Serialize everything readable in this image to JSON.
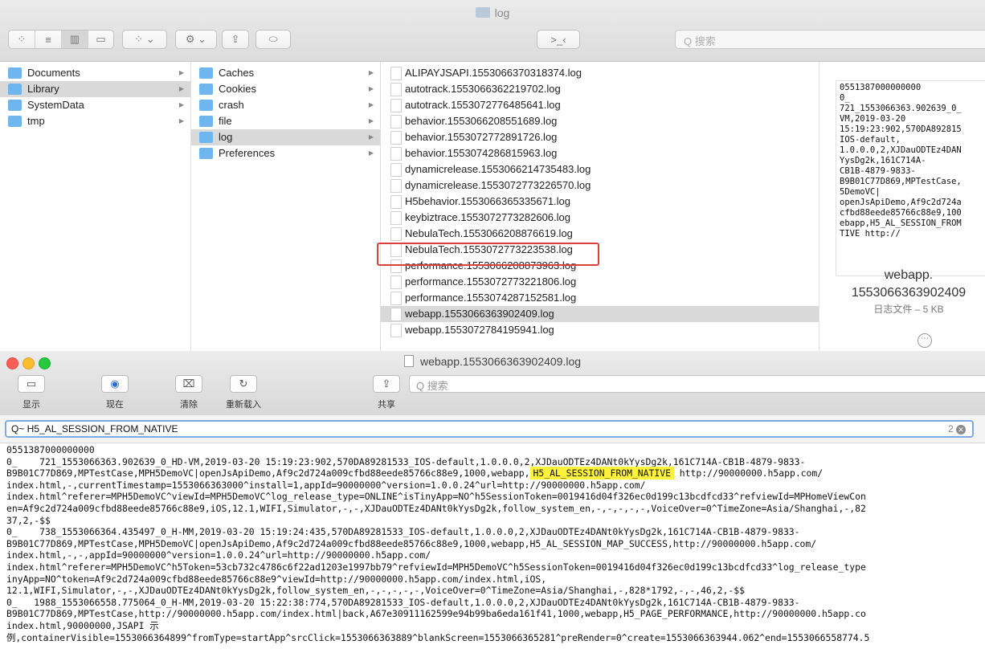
{
  "finder": {
    "title": "log",
    "search_placeholder": "Q 搜索",
    "view_buttons": [
      "icon-view",
      "list-view",
      "column-view",
      "gallery-view"
    ],
    "column1": [
      {
        "label": "Documents",
        "has_children": true
      },
      {
        "label": "Library",
        "has_children": true,
        "selected": true
      },
      {
        "label": "SystemData",
        "has_children": true
      },
      {
        "label": "tmp",
        "has_children": true
      }
    ],
    "column2": [
      {
        "label": "Caches",
        "has_children": true
      },
      {
        "label": "Cookies",
        "has_children": true
      },
      {
        "label": "crash",
        "has_children": true
      },
      {
        "label": "file",
        "has_children": true
      },
      {
        "label": "log",
        "has_children": true,
        "selected": true
      },
      {
        "label": "Preferences",
        "has_children": true
      }
    ],
    "files": [
      "ALIPAYJSAPI.1553066370318374.log",
      "autotrack.1553066362219702.log",
      "autotrack.1553072776485641.log",
      "behavior.1553066208551689.log",
      "behavior.1553072772891726.log",
      "behavior.1553074286815963.log",
      "dynamicrelease.1553066214735483.log",
      "dynamicrelease.1553072773226570.log",
      "H5behavior.1553066365335671.log",
      "keybiztrace.1553072773282606.log",
      "NebulaTech.1553066208876619.log",
      "NebulaTech.1553072773223538.log",
      "performance.1553066208873963.log",
      "performance.1553072773221806.log",
      "performance.1553074287152581.log",
      "webapp.1553066363902409.log",
      "webapp.1553072784195941.log"
    ],
    "selected_file_index": 15,
    "preview": {
      "text": "0551387000000000\n0_\n721_1553066363.902639_0_\nVM,2019-03-20\n15:19:23:902,570DA892815\nIOS-default,\n1.0.0.0,2,XJDauODTEz4DAN\nYysDg2k,161C714A-\nCB1B-4879-9833-\nB9B01C77D869,MPTestCase,\n5DemoVC|\nopenJsApiDemo,Af9c2d724a\ncfbd88eede85766c88e9,100\nebapp,H5_AL_SESSION_FROM\nTIVE http://",
      "name": "webapp.\n1553066363902409",
      "meta": "日志文件 – 5 KB"
    }
  },
  "console": {
    "title": "webapp.1553066363902409.log",
    "toolbar": [
      {
        "name": "show-button",
        "label": "显示",
        "glyph": "▭"
      },
      {
        "name": "now-button",
        "label": "现在",
        "glyph": "◉"
      },
      {
        "name": "clear-button",
        "label": "清除",
        "glyph": "⌧"
      },
      {
        "name": "reload-button",
        "label": "重新载入",
        "glyph": "↻"
      },
      {
        "name": "share-button",
        "label": "共享",
        "glyph": "⇪"
      }
    ],
    "search_placeholder": "Q 搜索",
    "filter_value": "Q~ H5_AL_SESSION_FROM_NATIVE",
    "filter_count": "2",
    "highlight": "H5_AL_SESSION_FROM_NATIVE",
    "log_lines": [
      "0551387000000000",
      "0_    721_1553066363.902639_0_HD-VM,2019-03-20 15:19:23:902,570DA89281533_IOS-default,1.0.0.0,2,XJDauODTEz4DANt0kYysDg2k,161C714A-CB1B-4879-9833-",
      "B9B01C77D869,MPTestCase,MPH5DemoVC|openJsApiDemo,Af9c2d724a009cfbd88eede85766c88e9,1000,webapp,{{HL}} http://90000000.h5app.com/",
      "index.html,-,currentTimestamp=1553066363000^install=1,appId=90000000^version=1.0.0.24^url=http://90000000.h5app.com/",
      "index.html^referer=MPH5DemoVC^viewId=MPH5DemoVC^log_release_type=ONLINE^isTinyApp=NO^h5SessionToken=0019416d04f326ec0d199c13bcdfcd33^refviewId=MPHomeViewCon",
      "en=Af9c2d724a009cfbd88eede85766c88e9,iOS,12.1,WIFI,Simulator,-,-,XJDauODTEz4DANt0kYysDg2k,follow_system_en,-,-,-,-,-,VoiceOver=0^TimeZone=Asia/Shanghai,-,82",
      "37,2,-$$",
      "0_    738_1553066364.435497_0_H-MM,2019-03-20 15:19:24:435,570DA89281533_IOS-default,1.0.0.0,2,XJDauODTEz4DANt0kYysDg2k,161C714A-CB1B-4879-9833-",
      "B9B01C77D869,MPTestCase,MPH5DemoVC|openJsApiDemo,Af9c2d724a009cfbd88eede85766c88e9,1000,webapp,H5_AL_SESSION_MAP_SUCCESS,http://90000000.h5app.com/",
      "index.html,-,-,appId=90000000^version=1.0.0.24^url=http://90000000.h5app.com/",
      "index.html^referer=MPH5DemoVC^h5Token=53cb732c4786c6f22ad1203e1997bb79^refviewId=MPH5DemoVC^h5SessionToken=0019416d04f326ec0d199c13bcdfcd33^log_release_type",
      "inyApp=NO^token=Af9c2d724a009cfbd88eede85766c88e9^viewId=http://90000000.h5app.com/index.html,iOS,",
      "12.1,WIFI,Simulator,-,-,XJDauODTEz4DANt0kYysDg2k,follow_system_en,-,-,-,-,-,VoiceOver=0^TimeZone=Asia/Shanghai,-,828*1792,-,-,46,2,-$$",
      "0_   1988_1553066558.775064_0_H-MM,2019-03-20 15:22:38:774,570DA89281533_IOS-default,1.0.0.0,2,XJDauODTEz4DANt0kYysDg2k,161C714A-CB1B-4879-9833-",
      "B9B01C77D869,MPTestCase,http://90000000.h5app.com/index.html|back,A67e30911162599e94b99ba6eda161f41,1000,webapp,H5_PAGE_PERFORMANCE,http://90000000.h5app.co",
      "index.html,90000000,JSAPI 示",
      "例,containerVisible=1553066364899^fromType=startApp^srcClick=1553066363889^blankScreen=1553066365281^preRender=0^create=1553066363944.062^end=1553066558774.5"
    ]
  }
}
